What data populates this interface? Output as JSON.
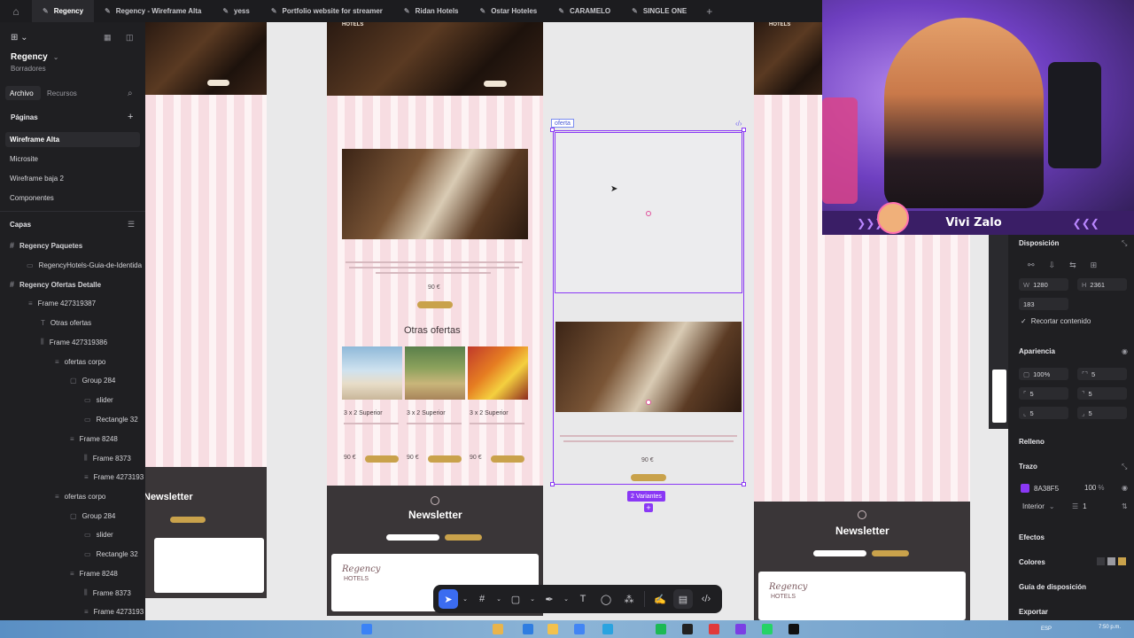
{
  "tabs": [
    {
      "label": "Regency",
      "active": true
    },
    {
      "label": "Regency - Wireframe Alta",
      "active": false
    },
    {
      "label": "yess",
      "active": false
    },
    {
      "label": "Portfolio website for streamer",
      "active": false
    },
    {
      "label": "Ridan Hotels",
      "active": false
    },
    {
      "label": "Ostar Hoteles",
      "active": false
    },
    {
      "label": "CARAMELO",
      "active": false
    },
    {
      "label": "SINGLE ONE",
      "active": false
    }
  ],
  "sidebar": {
    "project_title": "Regency",
    "project_subtitle": "Borradores",
    "tab_file": "Archivo",
    "tab_resources": "Recursos",
    "pages_header": "Páginas",
    "pages": [
      "Wireframe Alta",
      "Microsite",
      "Wireframe baja 2",
      "Componentes"
    ],
    "layers_header": "Capas",
    "layers": [
      "Regency Paquetes",
      "RegencyHotels-Guia-de-Identida",
      "Regency Ofertas Detalle",
      "Frame 427319387",
      "Otras ofertas",
      "Frame 427319386",
      "ofertas corpo",
      "Group 284",
      "slider",
      "Rectangle 32",
      "Frame 8248",
      "Frame 8373",
      "Frame 4273193",
      "ofertas corpo",
      "Group 284",
      "slider",
      "Rectangle 32",
      "Frame 8248",
      "Frame 8373",
      "Frame 4273193"
    ]
  },
  "canvas": {
    "hotels_label": "HOTELS",
    "other_offers_title": "Otras ofertas",
    "offer_card_title": "3 x 2 Superior",
    "price": "90 €",
    "newsletter_title": "Newsletter",
    "selection_label": "oferta",
    "variants_badge": "2 Variantes",
    "logo_text": "Regency",
    "logo_sub": "HOTELS"
  },
  "webcam": {
    "streamer_name": "Vivi Zalo"
  },
  "right_panel": {
    "layout_header": "Disposición",
    "width_label": "W",
    "width_value": "1280",
    "height_label": "H",
    "height_value": "2361",
    "gap_value": "183",
    "clip_content": "Recortar contenido",
    "appearance_header": "Apariencia",
    "opacity": "100%",
    "radius": "5",
    "radius_tl": "5",
    "radius_tr": "5",
    "radius_bl": "5",
    "radius_br": "5",
    "fill_header": "Relleno",
    "stroke_header": "Trazo",
    "stroke_color": "8A38F5",
    "stroke_opacity": "100",
    "stroke_opacity_unit": "%",
    "stroke_position": "Interior",
    "stroke_width": "1",
    "effects_header": "Efectos",
    "colors_header": "Colores",
    "grid_header": "Guía de disposición",
    "export_header": "Exportar"
  },
  "taskbar": {
    "language": "ESP",
    "time": "7:50 p.m."
  },
  "colors": {
    "accent": "#8a38f5",
    "selected_tool": "#3b6cf0",
    "gold_button": "#c9a24b",
    "stripe_pink": "#f7dde2"
  },
  "icons": [
    "home-icon",
    "grid-icon",
    "search-icon",
    "plus-icon",
    "list-icon",
    "pointer-icon",
    "frame-icon",
    "rect-icon",
    "pen-icon",
    "text-icon",
    "comment-icon",
    "components-icon",
    "code-icon",
    "eye-icon",
    "lock-icon"
  ]
}
